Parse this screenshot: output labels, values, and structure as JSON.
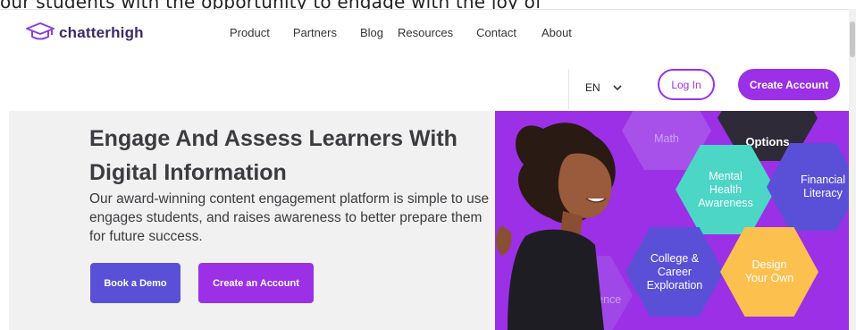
{
  "top_text": "our students with the opportunity to engage with the joy of",
  "logo": {
    "text": "chatterhigh",
    "icon": "graduation-cap-icon"
  },
  "nav": {
    "items": [
      "Product",
      "Partners",
      "Blog",
      "Resources",
      "Contact",
      "About"
    ]
  },
  "language": {
    "value": "EN",
    "icon": "chevron-down-icon"
  },
  "header_buttons": {
    "login": "Log In",
    "create": "Create Account"
  },
  "hero": {
    "title_line1": "Engage And Assess Learners With",
    "title_line2": "Digital Information",
    "subtitle": "Our award-winning content engagement platform is simple to use, engages students, and raises awareness to better prepare them for future success.",
    "book_demo": "Book a Demo",
    "create_account": "Create an Account"
  },
  "illustration": {
    "hexes": [
      {
        "id": "math",
        "label": "Math"
      },
      {
        "id": "options",
        "label": "Options"
      },
      {
        "id": "mental-health",
        "label": "Mental Health Awareness"
      },
      {
        "id": "financial",
        "label": "Financial Literacy"
      },
      {
        "id": "science",
        "label": "Science"
      },
      {
        "id": "college",
        "label": "College & Career Exploration"
      },
      {
        "id": "design",
        "label": "Design Your Own"
      }
    ]
  },
  "colors": {
    "purple": "#9b30e6",
    "indigo": "#5a50d8",
    "teal": "#4bd6c6",
    "yellow": "#fcc04f",
    "dark": "#2f2a38"
  }
}
